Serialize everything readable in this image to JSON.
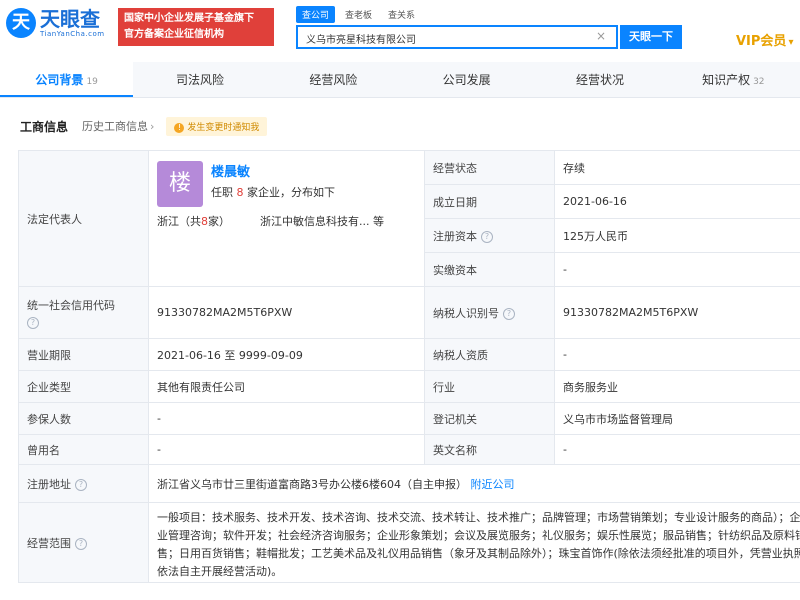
{
  "header": {
    "logo_mark": "天",
    "logo_cn": "天眼查",
    "logo_en": "TianYanCha.com",
    "gov_banner_line1": "国家中小企业发展子基金旗下",
    "gov_banner_line2": "官方备案企业征信机构",
    "search_tabs": [
      "查公司",
      "查老板",
      "查关系"
    ],
    "search_value": "义乌市亮星科技有限公司",
    "search_button": "天眼一下",
    "vip": "VIP会员"
  },
  "nav": {
    "items": [
      {
        "label": "公司背景",
        "count": "19"
      },
      {
        "label": "司法风险",
        "count": ""
      },
      {
        "label": "经营风险",
        "count": ""
      },
      {
        "label": "公司发展",
        "count": ""
      },
      {
        "label": "经营状况",
        "count": ""
      },
      {
        "label": "知识产权",
        "count": "32"
      }
    ]
  },
  "subhead": {
    "title": "工商信息",
    "history": "历史工商信息",
    "badge": "发生变更时通知我"
  },
  "legal_rep": {
    "label": "法定代表人",
    "avatar": "楼",
    "name": "楼晨敏",
    "role_prefix": "任职",
    "role_count": "8",
    "role_suffix": "家企业，分布如下",
    "region_prefix": "浙江（共",
    "region_count": "8",
    "region_suffix": "家）",
    "company": "浙江中敏信息科技有...",
    "etc": "等"
  },
  "rows": {
    "status_label": "经营状态",
    "status_value": "存续",
    "founded_label": "成立日期",
    "founded_value": "2021-06-16",
    "reg_cap_label": "注册资本",
    "reg_cap_value": "125万人民币",
    "paid_cap_label": "实缴资本",
    "paid_cap_value": "-",
    "uscc_label": "统一社会信用代码",
    "uscc_value": "91330782MA2M5T6PXW",
    "taxid_label": "纳税人识别号",
    "taxid_value": "91330782MA2M5T6PXW",
    "term_label": "营业期限",
    "term_value": "2021-06-16  至 9999-09-09",
    "tax_qual_label": "纳税人资质",
    "tax_qual_value": "-",
    "type_label": "企业类型",
    "type_value": "其他有限责任公司",
    "industry_label": "行业",
    "industry_value": "商务服务业",
    "insured_label": "参保人数",
    "insured_value": "-",
    "reg_auth_label": "登记机关",
    "reg_auth_value": "义乌市市场监督管理局",
    "former_label": "曾用名",
    "former_value": "-",
    "en_name_label": "英文名称",
    "en_name_value": "-",
    "address_label": "注册地址",
    "address_value": "浙江省义乌市廿三里街道富商路3号办公楼6楼604（自主申报）",
    "address_link": "附近公司",
    "scope_label": "经营范围",
    "scope_value": "一般项目：技术服务、技术开发、技术咨询、技术交流、技术转让、技术推广；品牌管理；市场营销策划；专业设计服务的商品）；企业管理咨询；软件开发；社会经济咨询服务；企业形象策划；会议及展览服务；礼仪服务；娱乐性展览；服品销售；针纺织品及原料销售；日用百货销售；鞋帽批发；工艺美术品及礼仪用品销售（象牙及其制品除外）；珠宝首饰作(除依法须经批准的项目外，凭营业执照依法自主开展经营活动)。"
  }
}
